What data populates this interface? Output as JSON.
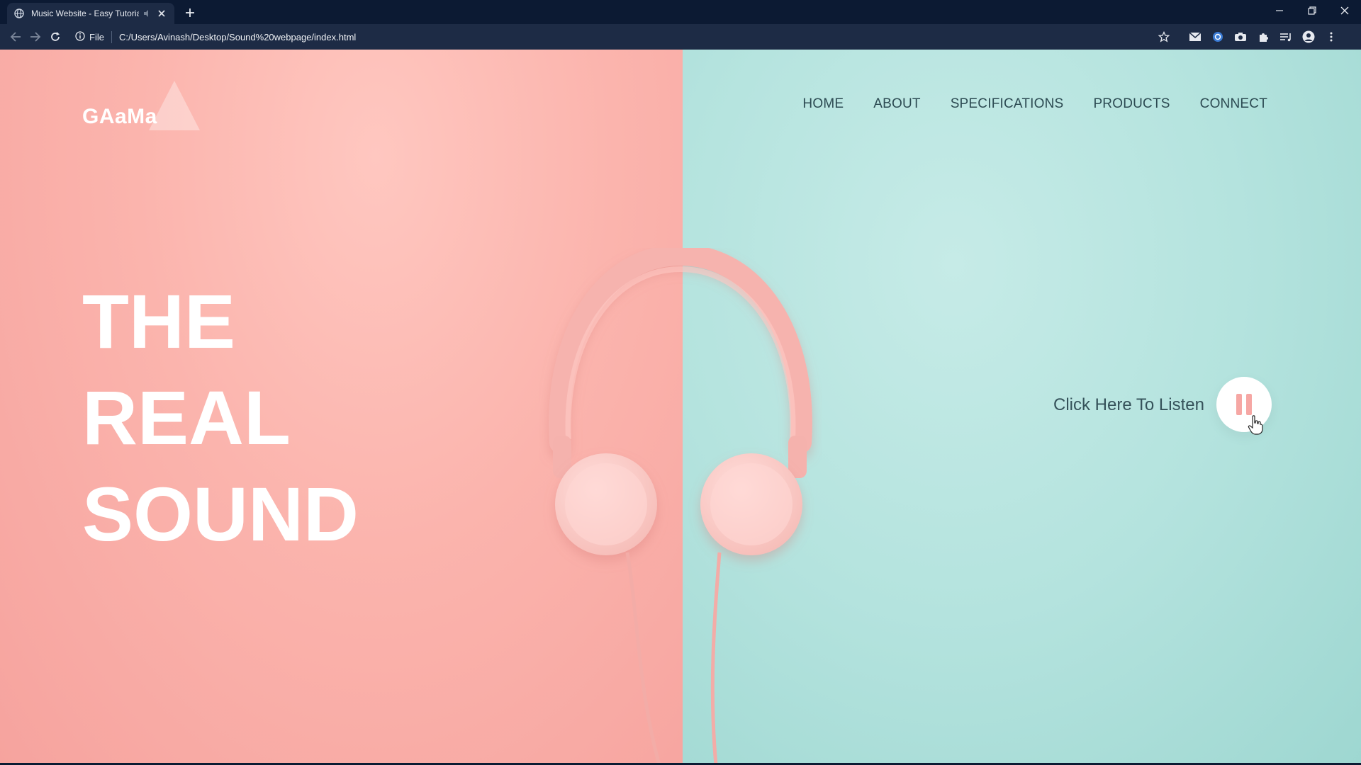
{
  "browser": {
    "tab": {
      "title": "Music Website - Easy Tutoria",
      "favicon": "globe-icon"
    },
    "address": {
      "scheme_label": "File",
      "url": "C:/Users/Avinash/Desktop/Sound%20webpage/index.html"
    }
  },
  "site": {
    "logo": "GAaMa",
    "nav": [
      "HOME",
      "ABOUT",
      "SPECIFICATIONS",
      "PRODUCTS",
      "CONNECT"
    ],
    "hero": {
      "line1": "THE",
      "line2": "REAL",
      "line3": "SOUND"
    },
    "listen": {
      "label": "Click Here To Listen",
      "state_icon": "pause-icon"
    }
  },
  "colors": {
    "left_bg": "#f9b0aa",
    "right_bg": "#b6e4df",
    "nav_text": "#2c4a52",
    "accent": "#f6a7a4"
  }
}
